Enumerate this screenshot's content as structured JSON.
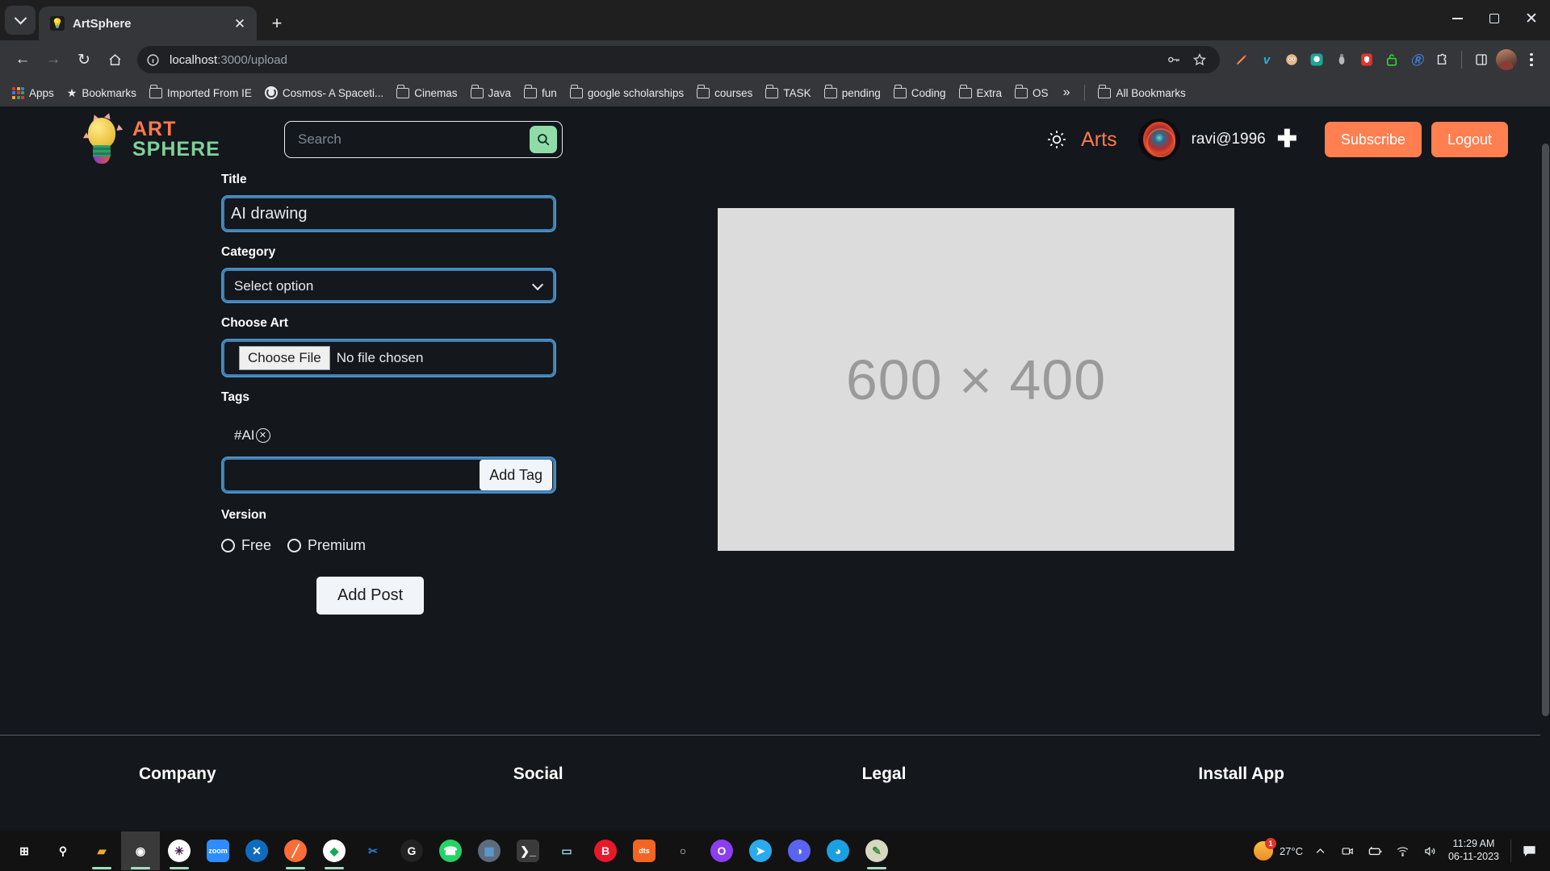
{
  "browser": {
    "tab": {
      "title": "ArtSphere",
      "favicon": "lightbulb-icon",
      "close": "✕"
    },
    "new_tab_label": "+",
    "window_controls": {
      "minimize": "minimize-icon",
      "maximize": "maximize-icon",
      "close": "✕"
    },
    "nav": {
      "back": "←",
      "forward": "→",
      "reload": "↻",
      "home": "home-icon"
    },
    "omnibox": {
      "url_host": "localhost",
      "url_path": ":3000/upload",
      "info_icon": "info-circle-icon",
      "password_icon": "key-icon",
      "bookmark_icon": "star-icon"
    },
    "extensions": [
      {
        "name": "pen-icon",
        "glyph": "✎",
        "color": "#ff8c3a"
      },
      {
        "name": "vimeo-icon",
        "glyph": "v",
        "color": "#1ab7ea"
      },
      {
        "name": "face-icon",
        "glyph": "●",
        "color": "#e8b88a"
      },
      {
        "name": "chat-bubble-icon",
        "glyph": "●",
        "color": "#1aa79a"
      },
      {
        "name": "bug-icon",
        "glyph": "●",
        "color": "#b8b8b8"
      },
      {
        "name": "adblock-shield-icon",
        "glyph": "●",
        "color": "#e3342f"
      },
      {
        "name": "unlock-icon",
        "glyph": "●",
        "color": "#2ee02e"
      },
      {
        "name": "readwise-icon",
        "glyph": "R",
        "color": "#3a7fd4"
      },
      {
        "name": "puzzle-icon",
        "glyph": "●",
        "color": "#e8eaed"
      },
      {
        "name": "sidebar-icon",
        "glyph": "▧",
        "color": "#e8eaed"
      }
    ],
    "bookmarks": [
      {
        "label": "Apps",
        "icon": "apps-grid-icon"
      },
      {
        "label": "Bookmarks",
        "icon": "star-icon"
      },
      {
        "label": "Imported From IE",
        "icon": "folder-icon"
      },
      {
        "label": "Cosmos- A Spaceti...",
        "icon": "globe-icon"
      },
      {
        "label": "Cinemas",
        "icon": "folder-icon"
      },
      {
        "label": "Java",
        "icon": "folder-icon"
      },
      {
        "label": "fun",
        "icon": "folder-icon"
      },
      {
        "label": "google scholarships",
        "icon": "folder-icon"
      },
      {
        "label": "courses",
        "icon": "folder-icon"
      },
      {
        "label": "TASK",
        "icon": "folder-icon"
      },
      {
        "label": "pending",
        "icon": "folder-icon"
      },
      {
        "label": "Coding",
        "icon": "folder-icon"
      },
      {
        "label": "Extra",
        "icon": "folder-icon"
      },
      {
        "label": "OS",
        "icon": "folder-icon"
      }
    ],
    "bookmarks_overflow": "»",
    "all_bookmarks": "All Bookmarks"
  },
  "site": {
    "logo": {
      "line1": "ART",
      "line2": "SPHERE",
      "color1": "#ff7a4d",
      "color2": "#7fd19a"
    },
    "search": {
      "placeholder": "Search",
      "value": "",
      "button_icon": "search-icon",
      "button_color": "#8fdca9"
    },
    "theme_toggle_icon": "sun-icon",
    "arts_link": "Arts",
    "username": "ravi@1996",
    "add_icon": "plus-icon",
    "subscribe_label": "Subscribe",
    "logout_label": "Logout",
    "accent_orange": "#ff7f50"
  },
  "form": {
    "title_label": "Title",
    "title_value": "AI drawing",
    "title_placeholder": "",
    "category_label": "Category",
    "category_selected": "Select option",
    "category_options": [
      "Select option"
    ],
    "choose_art_label": "Choose Art",
    "file_button_label": "Choose File",
    "file_status": "No file chosen",
    "tags_label": "Tags",
    "tags": [
      {
        "label": "#AI",
        "remove_icon": "close-circle-icon"
      }
    ],
    "tag_input_value": "",
    "tag_input_placeholder": "",
    "add_tag_label": "Add Tag",
    "version_label": "Version",
    "version_options": [
      {
        "label": "Free",
        "selected": false
      },
      {
        "label": "Premium",
        "selected": false
      }
    ],
    "submit_label": "Add Post"
  },
  "preview": {
    "placeholder_text": "600 × 400"
  },
  "footer": {
    "columns": [
      {
        "heading": "Company"
      },
      {
        "heading": "Social"
      },
      {
        "heading": "Legal"
      },
      {
        "heading": "Install App"
      }
    ]
  },
  "taskbar": {
    "items": [
      {
        "name": "windows-start-icon",
        "glyph": "⊞",
        "color": "#ffffff",
        "bg": "transparent",
        "active": false,
        "running": false
      },
      {
        "name": "search-icon",
        "glyph": "⚲",
        "color": "#ffffff",
        "bg": "transparent",
        "active": false,
        "running": false
      },
      {
        "name": "file-explorer-icon",
        "glyph": "▰",
        "color": "#f0a830",
        "bg": "transparent",
        "active": false,
        "running": true
      },
      {
        "name": "chrome-icon",
        "glyph": "◉",
        "color": "#ffffff",
        "bg": "transparent",
        "active": true,
        "running": true
      },
      {
        "name": "slack-icon",
        "glyph": "✳",
        "color": "#4a154b",
        "bg": "#ffffff",
        "active": false,
        "running": true
      },
      {
        "name": "zoom-icon",
        "glyph": "zoom",
        "color": "#ffffff",
        "bg": "#2d8cff",
        "active": false,
        "running": false
      },
      {
        "name": "vscode-icon",
        "glyph": "✕",
        "color": "#ffffff",
        "bg": "#0f6cbd",
        "active": false,
        "running": false
      },
      {
        "name": "postman-icon",
        "glyph": "╱",
        "color": "#ffffff",
        "bg": "#ff6c37",
        "active": false,
        "running": true
      },
      {
        "name": "mongodb-icon",
        "glyph": "◆",
        "color": "#13aa52",
        "bg": "#ffffff",
        "active": false,
        "running": true
      },
      {
        "name": "snipping-tool-icon",
        "glyph": "✂",
        "color": "#2a7fd4",
        "bg": "transparent",
        "active": false,
        "running": false
      },
      {
        "name": "logitech-icon",
        "glyph": "G",
        "color": "#ffffff",
        "bg": "#222222",
        "active": false,
        "running": false
      },
      {
        "name": "whatsapp-icon",
        "glyph": "☎",
        "color": "#ffffff",
        "bg": "#25d366",
        "active": false,
        "running": false
      },
      {
        "name": "calculator-icon",
        "glyph": "▦",
        "color": "#5a9bd5",
        "bg": "#5d6b7a",
        "active": false,
        "running": false
      },
      {
        "name": "terminal-icon",
        "glyph": "❯_",
        "color": "#ffffff",
        "bg": "#3b3b3b",
        "active": false,
        "running": false
      },
      {
        "name": "notepad-icon",
        "glyph": "▭",
        "color": "#9fd4e8",
        "bg": "transparent",
        "active": false,
        "running": false
      },
      {
        "name": "brave-icon",
        "glyph": "B",
        "color": "#ffffff",
        "bg": "#e8182b",
        "active": false,
        "running": false
      },
      {
        "name": "dts-icon",
        "glyph": "dts",
        "color": "#ffffff",
        "bg": "#f26522",
        "active": false,
        "running": false
      },
      {
        "name": "obs-icon",
        "glyph": "○",
        "color": "#e8eaed",
        "bg": "transparent",
        "active": false,
        "running": false
      },
      {
        "name": "opera-gx-icon",
        "glyph": "O",
        "color": "#ffffff",
        "bg": "#8b3ff0",
        "active": false,
        "running": false
      },
      {
        "name": "telegram-icon",
        "glyph": "➤",
        "color": "#ffffff",
        "bg": "#2aabee",
        "active": false,
        "running": false
      },
      {
        "name": "discord-icon",
        "glyph": "◑",
        "color": "#ffffff",
        "bg": "#5865f2",
        "active": false,
        "running": false
      },
      {
        "name": "firefox-icon",
        "glyph": "◕",
        "color": "#ffffff",
        "bg": "#1a9fe0",
        "active": false,
        "running": false
      },
      {
        "name": "paint-icon",
        "glyph": "✎",
        "color": "#2f8f3f",
        "bg": "#d8d8c0",
        "active": false,
        "running": true
      }
    ],
    "tray": {
      "weather_temp": "27°C",
      "weather_badge": "1",
      "chevron_icon": "chevron-up-icon",
      "camera_icon": "camera-icon",
      "battery_icon": "battery-icon",
      "wifi_icon": "wifi-icon",
      "volume_icon": "volume-icon",
      "time": "11:29 AM",
      "date": "06-11-2023",
      "notification_icon": "notification-icon"
    }
  }
}
